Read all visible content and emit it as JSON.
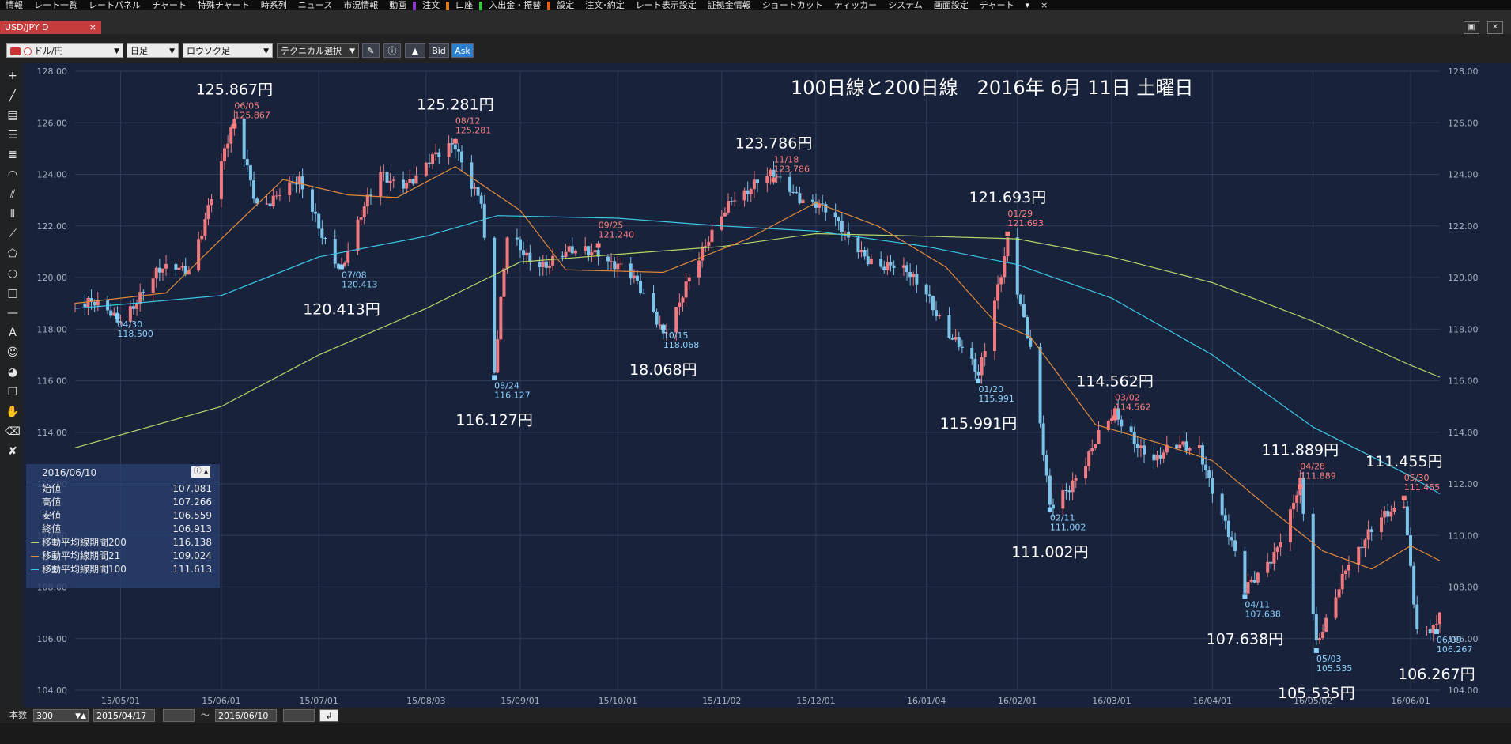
{
  "menu": {
    "items": [
      "情報",
      "レート一覧",
      "レートパネル",
      "チャート",
      "特殊チャート",
      "時系列",
      "ニュース",
      "市況情報",
      "動画",
      "注文",
      "口座",
      "入出金・振替",
      "設定",
      "注文･約定",
      "レート表示設定",
      "証拠金情報",
      "ショートカット",
      "ティッカー",
      "システム",
      "画面設定",
      "チャート"
    ],
    "close": "×"
  },
  "window": {
    "tab_label": "USD/JPY D",
    "tab_close": "×"
  },
  "toolbar": {
    "symbol": "ドル/円",
    "timeframe": "日足",
    "chart_type": "ロウソク足",
    "technical": "テクニカル選択",
    "bid": "Bid",
    "ask": "Ask"
  },
  "info_panel": {
    "date": "2016/06/10",
    "rows": [
      {
        "label": "始値",
        "value": "107.081"
      },
      {
        "label": "高値",
        "value": "107.266"
      },
      {
        "label": "安値",
        "value": "106.559"
      },
      {
        "label": "終値",
        "value": "106.913"
      },
      {
        "label": "移動平均線期間200",
        "value": "116.138",
        "color": "#b8d46a"
      },
      {
        "label": "移動平均線期間21",
        "value": "109.024",
        "color": "#e08a3c"
      },
      {
        "label": "移動平均線期間100",
        "value": "111.613",
        "color": "#3cc8e8"
      }
    ]
  },
  "status": {
    "count_label": "本数",
    "count_value": "300",
    "from_date": "2015/04/17",
    "tilde": "〜",
    "to_date": "2016/06/10"
  },
  "chart_data": {
    "type": "candlestick",
    "title": "100日線と200日線　2016年 6月 11日 土曜日",
    "ylim": [
      104,
      128
    ],
    "yticks": [
      "128.00",
      "126.00",
      "124.00",
      "122.00",
      "120.00",
      "118.00",
      "116.00",
      "114.00",
      "112.00",
      "110.00",
      "108.00",
      "106.00",
      "104.00"
    ],
    "xtick_labels": [
      "15/05/01",
      "15/06/01",
      "15/07/01",
      "15/08/03",
      "15/09/01",
      "15/10/01",
      "15/11/02",
      "15/12/01",
      "16/01/04",
      "16/02/01",
      "16/03/01",
      "16/04/01",
      "16/05/02",
      "16/06/01"
    ],
    "colors": {
      "up": "#f07a80",
      "down": "#7cc3ea",
      "ma200": "#b8d46a",
      "ma21": "#e08a3c",
      "ma100": "#3cc8e8",
      "high_label": "#ff8080",
      "low_label": "#8cd2ff"
    },
    "price_path": [
      [
        "2015/04/17",
        119.0
      ],
      [
        "2015/04/30",
        118.5
      ],
      [
        "2015/05/12",
        120.0
      ],
      [
        "2015/05/22",
        120.5
      ],
      [
        "2015/06/01",
        124.3
      ],
      [
        "2015/06/05",
        125.867
      ],
      [
        "2015/06/12",
        123.0
      ],
      [
        "2015/06/25",
        123.5
      ],
      [
        "2015/07/08",
        120.413
      ],
      [
        "2015/07/20",
        124.0
      ],
      [
        "2015/07/31",
        123.8
      ],
      [
        "2015/08/12",
        125.281
      ],
      [
        "2015/08/20",
        123.0
      ],
      [
        "2015/08/24",
        116.127
      ],
      [
        "2015/08/28",
        121.5
      ],
      [
        "2015/09/10",
        120.5
      ],
      [
        "2015/09/25",
        121.24
      ],
      [
        "2015/10/05",
        119.9
      ],
      [
        "2015/10/15",
        118.068
      ],
      [
        "2015/10/28",
        121.0
      ],
      [
        "2015/11/05",
        123.3
      ],
      [
        "2015/11/18",
        123.786
      ],
      [
        "2015/12/01",
        123.0
      ],
      [
        "2015/12/10",
        121.5
      ],
      [
        "2015/12/25",
        120.3
      ],
      [
        "2016/01/04",
        119.5
      ],
      [
        "2016/01/20",
        115.991
      ],
      [
        "2016/01/29",
        121.693
      ],
      [
        "2016/02/05",
        117.0
      ],
      [
        "2016/02/11",
        111.002
      ],
      [
        "2016/02/22",
        113.0
      ],
      [
        "2016/03/02",
        114.562
      ],
      [
        "2016/03/15",
        113.0
      ],
      [
        "2016/03/28",
        113.5
      ],
      [
        "2016/04/05",
        110.5
      ],
      [
        "2016/04/11",
        107.638
      ],
      [
        "2016/04/20",
        109.5
      ],
      [
        "2016/04/28",
        111.889
      ],
      [
        "2016/05/03",
        105.535
      ],
      [
        "2016/05/12",
        109.0
      ],
      [
        "2016/05/20",
        110.0
      ],
      [
        "2016/05/30",
        111.455
      ],
      [
        "2016/06/03",
        106.5
      ],
      [
        "2016/06/09",
        106.267
      ],
      [
        "2016/06/10",
        106.913
      ]
    ],
    "ma200": [
      [
        "2015/04/17",
        113.4
      ],
      [
        "2015/06/01",
        115.0
      ],
      [
        "2015/07/01",
        117.0
      ],
      [
        "2015/08/03",
        118.8
      ],
      [
        "2015/09/01",
        120.6
      ],
      [
        "2015/10/01",
        120.9
      ],
      [
        "2015/11/02",
        121.2
      ],
      [
        "2015/12/01",
        121.7
      ],
      [
        "2016/01/04",
        121.6
      ],
      [
        "2016/02/01",
        121.5
      ],
      [
        "2016/03/01",
        120.8
      ],
      [
        "2016/04/01",
        119.8
      ],
      [
        "2016/05/02",
        118.3
      ],
      [
        "2016/06/01",
        116.6
      ],
      [
        "2016/06/10",
        116.138
      ]
    ],
    "ma100": [
      [
        "2015/04/17",
        118.8
      ],
      [
        "2015/06/01",
        119.3
      ],
      [
        "2015/07/01",
        120.8
      ],
      [
        "2015/08/03",
        121.6
      ],
      [
        "2015/08/25",
        122.4
      ],
      [
        "2015/10/01",
        122.3
      ],
      [
        "2015/11/02",
        122.0
      ],
      [
        "2015/12/01",
        121.8
      ],
      [
        "2016/01/04",
        121.2
      ],
      [
        "2016/02/01",
        120.5
      ],
      [
        "2016/03/01",
        119.2
      ],
      [
        "2016/04/01",
        117.0
      ],
      [
        "2016/05/02",
        114.2
      ],
      [
        "2016/06/01",
        112.3
      ],
      [
        "2016/06/10",
        111.613
      ]
    ],
    "ma21": [
      [
        "2015/04/17",
        119.0
      ],
      [
        "2015/05/15",
        119.4
      ],
      [
        "2015/06/01",
        121.5
      ],
      [
        "2015/06/20",
        123.8
      ],
      [
        "2015/07/10",
        123.2
      ],
      [
        "2015/07/25",
        123.1
      ],
      [
        "2015/08/12",
        124.3
      ],
      [
        "2015/09/01",
        122.6
      ],
      [
        "2015/09/15",
        120.3
      ],
      [
        "2015/10/15",
        120.2
      ],
      [
        "2015/11/10",
        121.5
      ],
      [
        "2015/12/01",
        122.9
      ],
      [
        "2015/12/20",
        122.0
      ],
      [
        "2016/01/10",
        120.4
      ],
      [
        "2016/01/25",
        118.3
      ],
      [
        "2016/02/05",
        117.7
      ],
      [
        "2016/02/25",
        114.3
      ],
      [
        "2016/03/15",
        113.6
      ],
      [
        "2016/04/01",
        112.9
      ],
      [
        "2016/04/20",
        110.9
      ],
      [
        "2016/05/05",
        109.4
      ],
      [
        "2016/05/20",
        108.7
      ],
      [
        "2016/06/01",
        109.6
      ],
      [
        "2016/06/10",
        109.024
      ]
    ],
    "marker_labels": [
      {
        "date": "2015/04/30",
        "price": 118.5,
        "kind": "low",
        "date_text": "04/30",
        "price_text": "118.500"
      },
      {
        "date": "2015/06/05",
        "price": 125.867,
        "kind": "high",
        "date_text": "06/05",
        "price_text": "125.867"
      },
      {
        "date": "2015/07/08",
        "price": 120.413,
        "kind": "low",
        "date_text": "07/08",
        "price_text": "120.413"
      },
      {
        "date": "2015/08/12",
        "price": 125.281,
        "kind": "high",
        "date_text": "08/12",
        "price_text": "125.281"
      },
      {
        "date": "2015/08/24",
        "price": 116.127,
        "kind": "low",
        "date_text": "08/24",
        "price_text": "116.127"
      },
      {
        "date": "2015/09/25",
        "price": 121.24,
        "kind": "high",
        "date_text": "09/25",
        "price_text": "121.240"
      },
      {
        "date": "2015/10/15",
        "price": 118.068,
        "kind": "low",
        "date_text": "10/15",
        "price_text": "118.068"
      },
      {
        "date": "2015/11/18",
        "price": 123.786,
        "kind": "high",
        "date_text": "11/18",
        "price_text": "123.786"
      },
      {
        "date": "2016/01/20",
        "price": 115.991,
        "kind": "low",
        "date_text": "01/20",
        "price_text": "115.991"
      },
      {
        "date": "2016/01/29",
        "price": 121.693,
        "kind": "high",
        "date_text": "01/29",
        "price_text": "121.693"
      },
      {
        "date": "2016/02/11",
        "price": 111.002,
        "kind": "low",
        "date_text": "02/11",
        "price_text": "111.002"
      },
      {
        "date": "2016/03/02",
        "price": 114.562,
        "kind": "high",
        "date_text": "03/02",
        "price_text": "114.562"
      },
      {
        "date": "2016/04/11",
        "price": 107.638,
        "kind": "low",
        "date_text": "04/11",
        "price_text": "107.638"
      },
      {
        "date": "2016/04/28",
        "price": 111.889,
        "kind": "high",
        "date_text": "04/28",
        "price_text": "111.889"
      },
      {
        "date": "2016/05/03",
        "price": 105.535,
        "kind": "low",
        "date_text": "05/03",
        "price_text": "105.535"
      },
      {
        "date": "2016/05/30",
        "price": 111.455,
        "kind": "high",
        "date_text": "05/30",
        "price_text": "111.455"
      },
      {
        "date": "2016/06/09",
        "price": 106.267,
        "kind": "low",
        "date_text": "06/09",
        "price_text": "106.267"
      }
    ],
    "big_annotations": [
      {
        "text": "125.867円",
        "date": "2015/06/05",
        "kind": "high"
      },
      {
        "text": "125.281円",
        "date": "2015/08/12",
        "kind": "high"
      },
      {
        "text": "120.413円",
        "date": "2015/07/08",
        "kind": "low"
      },
      {
        "text": "116.127円",
        "date": "2015/08/24",
        "kind": "low"
      },
      {
        "text": "18.068円",
        "date": "2015/10/15",
        "kind": "low"
      },
      {
        "text": "123.786円",
        "date": "2015/11/18",
        "kind": "high"
      },
      {
        "text": "121.693円",
        "date": "2016/01/29",
        "kind": "high"
      },
      {
        "text": "115.991円",
        "date": "2016/01/20",
        "kind": "low"
      },
      {
        "text": "111.002円",
        "date": "2016/02/11",
        "kind": "low"
      },
      {
        "text": "114.562円",
        "date": "2016/03/02",
        "kind": "high"
      },
      {
        "text": "107.638円",
        "date": "2016/04/11",
        "kind": "low"
      },
      {
        "text": "111.889円",
        "date": "2016/04/28",
        "kind": "high"
      },
      {
        "text": "105.535円",
        "date": "2016/05/03",
        "kind": "low"
      },
      {
        "text": "111.455円",
        "date": "2016/05/30",
        "kind": "high"
      },
      {
        "text": "106.267円",
        "date": "2016/06/09",
        "kind": "low"
      }
    ]
  }
}
